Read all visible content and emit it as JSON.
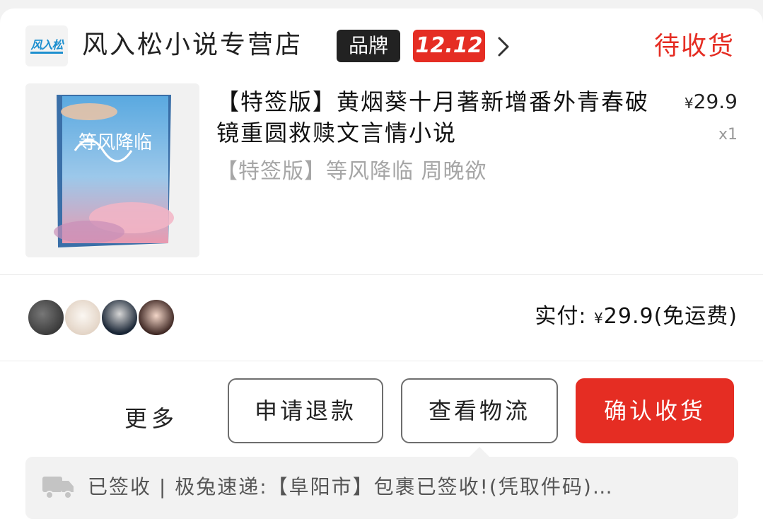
{
  "shop": {
    "logo_text": "风入松",
    "name": "风入松小说专营店",
    "brand_badge": "品牌",
    "promo_badge": "12.12"
  },
  "order": {
    "status": "待收货"
  },
  "product": {
    "title": "【特签版】黄烟葵十月著新增番外青春破镜重圆救赎文言情小说",
    "spec": "【特签版】等风降临 周晚欲",
    "price_symbol": "¥",
    "price": "29.9",
    "quantity": "x1",
    "cover_title": "等风降临"
  },
  "payment": {
    "label": "实付:",
    "symbol": "¥",
    "amount": "29.9",
    "note": "(免运费)"
  },
  "actions": {
    "more": "更多",
    "refund": "申请退款",
    "logistics": "查看物流",
    "confirm": "确认收货"
  },
  "logistics": {
    "text": "已签收 | 极兔速递:【阜阳市】包裹已签收!(凭取件码)…"
  },
  "colors": {
    "accent": "#e52d23",
    "dark_badge": "#222222",
    "muted_text": "#a6a6a6"
  }
}
